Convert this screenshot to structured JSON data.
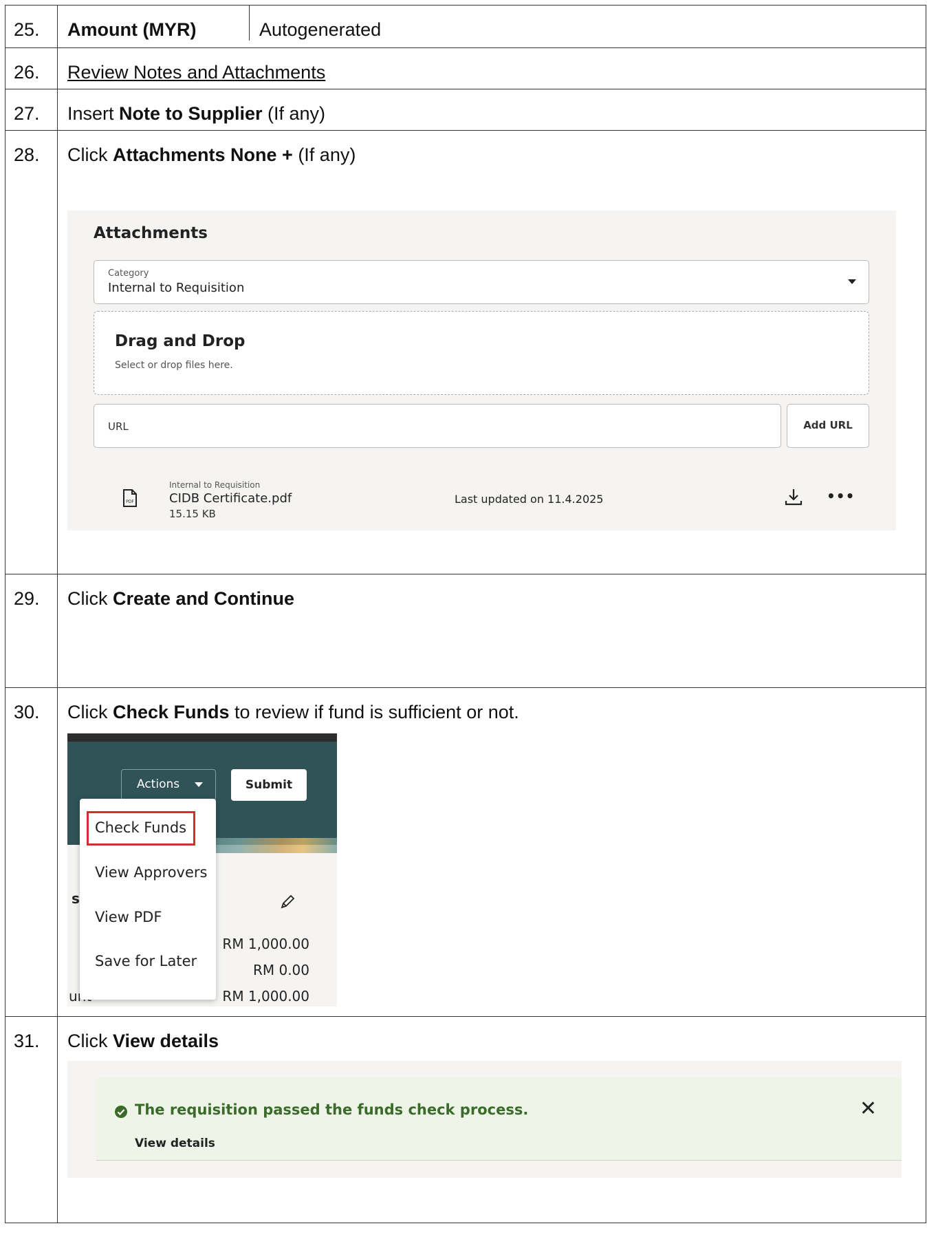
{
  "rows": [
    {
      "num": "25.",
      "label": "Amount (MYR)",
      "value": "Autogenerated"
    },
    {
      "num": "26.",
      "link": "Review Notes and Attachments"
    },
    {
      "num": "27.",
      "pre": "Insert ",
      "bold": "Note to Supplier",
      "post": " (If any)"
    },
    {
      "num": "28.",
      "pre": "Click ",
      "bold": "Attachments None +",
      "post": " (If any)"
    },
    {
      "num": "29.",
      "pre": "Click ",
      "bold": "Create and Continue",
      "post": ""
    },
    {
      "num": "30.",
      "pre": "Click ",
      "bold": "Check Funds",
      "post": " to review if fund is sufficient or not."
    },
    {
      "num": "31.",
      "pre": "Click ",
      "bold": "View details",
      "post": ""
    }
  ],
  "attachments": {
    "title": "Attachments",
    "category_label": "Category",
    "category_value": "Internal to Requisition",
    "drop_title": "Drag and Drop",
    "drop_subtitle": "Select or drop files here.",
    "url_placeholder": "URL",
    "add_url_label": "Add URL",
    "file": {
      "category": "Internal to Requisition",
      "name": "CIDB Certificate.pdf",
      "size": "15.15 KB",
      "updated": "Last updated on 11.4.2025",
      "icon": "pdf-file-icon",
      "more": "•••"
    }
  },
  "actions_shot": {
    "actions_label": "Actions",
    "submit_label": "Submit",
    "menu_items": [
      "Check Funds",
      "View Approvers",
      "View PDF",
      "Save for Later"
    ],
    "highlight_color": "#d12f2f",
    "header_color": "#2f5357",
    "amounts": [
      "RM 1,000.00",
      "RM 0.00",
      "RM 1,000.00"
    ],
    "fragment_s": "s",
    "fragment_unt": "unt"
  },
  "funds_banner": {
    "message": "The requisition passed the funds check process.",
    "link": "View details",
    "close": "✕",
    "success_color": "#3a6b2a"
  }
}
